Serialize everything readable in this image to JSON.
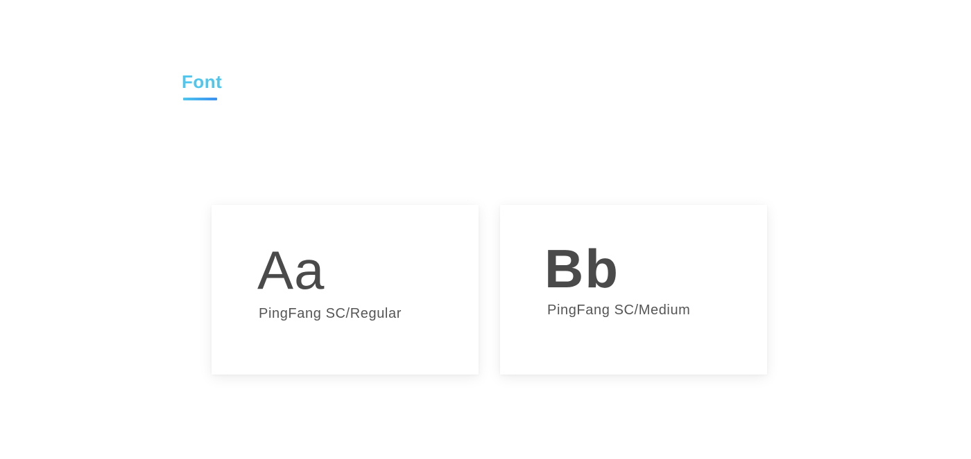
{
  "section": {
    "title": "Font",
    "accent_color": "#4ec6ee",
    "underline_gradient": [
      "#4ec6ee",
      "#3a8ff0"
    ]
  },
  "font_cards": [
    {
      "sample": "Aa",
      "name": "PingFang SC/Regular"
    },
    {
      "sample": "Bb",
      "name": "PingFang SC/Medium"
    }
  ],
  "colors": {
    "text": "#4a4a4a",
    "card_background": "#ffffff",
    "page_background": "#ffffff"
  }
}
